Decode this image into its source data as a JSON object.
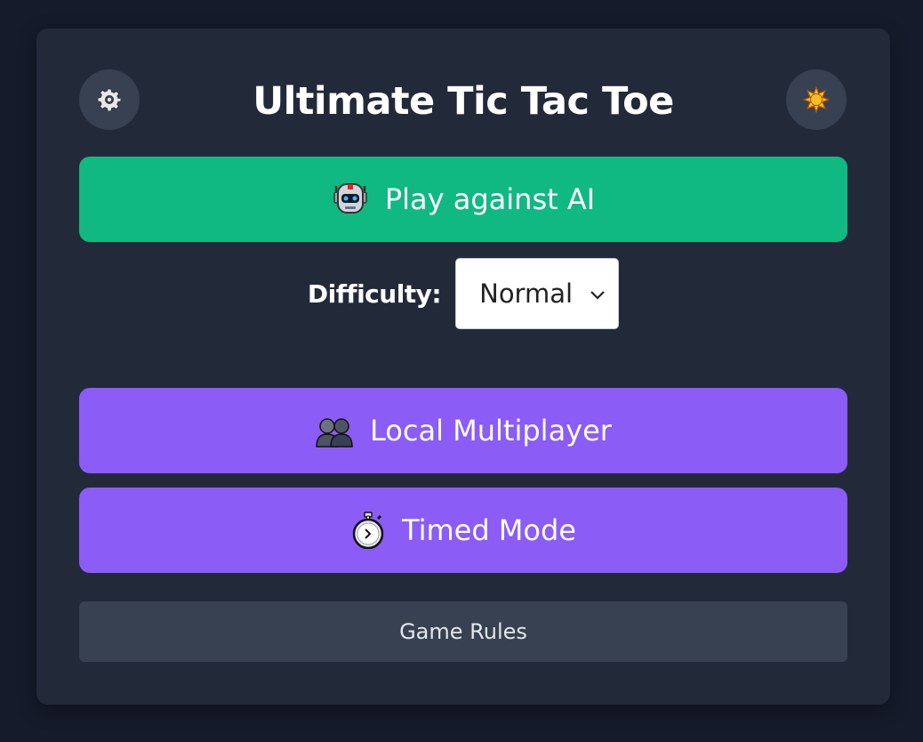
{
  "header": {
    "title": "Ultimate Tic Tac Toe",
    "settings_icon": "gear-icon",
    "theme_icon": "sun-icon"
  },
  "modes": {
    "ai": {
      "label": "Play against AI",
      "icon": "robot-icon",
      "color": "#10b981"
    },
    "multiplayer": {
      "label": "Local Multiplayer",
      "icon": "two-people-icon",
      "color": "#8b5cf6"
    },
    "timed": {
      "label": "Timed Mode",
      "icon": "stopwatch-icon",
      "color": "#8b5cf6"
    }
  },
  "difficulty": {
    "label": "Difficulty:",
    "selected": "Normal"
  },
  "rules": {
    "label": "Game Rules"
  },
  "colors": {
    "background": "#151b2a",
    "card": "#222a3a",
    "secondary_button": "#374151"
  }
}
